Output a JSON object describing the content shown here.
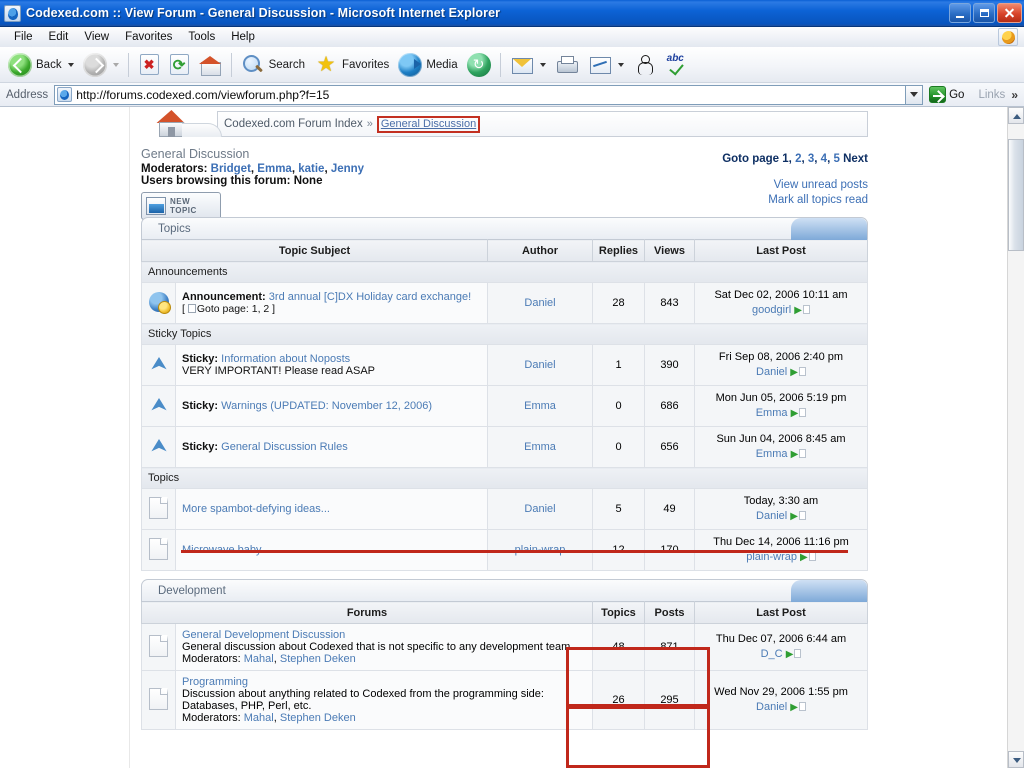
{
  "window": {
    "title": "Codexed.com :: View Forum - General Discussion - Microsoft Internet Explorer",
    "minimize_label": "Minimize",
    "maximize_label": "Restore",
    "close_label": "Close"
  },
  "menu": {
    "items": [
      "File",
      "Edit",
      "View",
      "Favorites",
      "Tools",
      "Help"
    ]
  },
  "toolbar": {
    "back": "Back",
    "forward": "",
    "stop": "",
    "refresh": "",
    "home": "",
    "search": "Search",
    "favorites": "Favorites",
    "media": "Media",
    "history": "",
    "mail": "",
    "print": "",
    "edit": "",
    "messenger": "",
    "spell": ""
  },
  "address": {
    "label": "Address",
    "url": "http://forums.codexed.com/viewforum.php?f=15",
    "go_label": "Go",
    "links_label": "Links",
    "overflow_label": "»"
  },
  "breadcrumb": {
    "root": "Codexed.com Forum Index",
    "separator": "»",
    "current": "General Discussion"
  },
  "forum_header": {
    "title": "General Discussion",
    "moderators_label": "Moderators:",
    "moderators": [
      "Bridget",
      "Emma",
      "katie",
      "Jenny"
    ],
    "users_browsing": "Users browsing this forum: None",
    "new_topic_line1": "NEW",
    "new_topic_line2": "TOPIC",
    "goto_label": "Goto page",
    "goto_pages": [
      "1",
      "2",
      "3",
      "4",
      "5"
    ],
    "goto_next": "Next",
    "view_unread": "View unread posts",
    "mark_read": "Mark all topics read"
  },
  "topics_section": {
    "tab_label": "Topics",
    "columns": [
      "Topic Subject",
      "Author",
      "Replies",
      "Views",
      "Last Post"
    ],
    "groups": [
      {
        "label": "Announcements",
        "rows": [
          {
            "icon": "announcement-icon",
            "prefix": "Announcement:",
            "subject": "3rd annual [C]DX Holiday card exchange!",
            "goto_prefix": "[",
            "goto_label": "Goto page:",
            "goto_pages": "1, 2",
            "goto_suffix": "]",
            "author": "Daniel",
            "replies": "28",
            "views": "843",
            "last_post_date": "Sat Dec 02, 2006 10:11 am",
            "last_post_author": "goodgirl"
          }
        ]
      },
      {
        "label": "Sticky Topics",
        "rows": [
          {
            "icon": "sticky-icon",
            "prefix": "Sticky:",
            "subject": "Information about Noposts",
            "subtitle": "VERY IMPORTANT! Please read ASAP",
            "author": "Daniel",
            "replies": "1",
            "views": "390",
            "last_post_date": "Fri Sep 08, 2006 2:40 pm",
            "last_post_author": "Daniel"
          },
          {
            "icon": "sticky-icon",
            "prefix": "Sticky:",
            "subject": "Warnings (UPDATED: November 12, 2006)",
            "author": "Emma",
            "replies": "0",
            "views": "686",
            "last_post_date": "Mon Jun 05, 2006 5:19 pm",
            "last_post_author": "Emma"
          },
          {
            "icon": "sticky-icon",
            "prefix": "Sticky:",
            "subject": "General Discussion Rules",
            "author": "Emma",
            "replies": "0",
            "views": "656",
            "last_post_date": "Sun Jun 04, 2006 8:45 am",
            "last_post_author": "Emma"
          }
        ]
      },
      {
        "label": "Topics",
        "rows": [
          {
            "icon": "document-icon",
            "subject": "More spambot-defying ideas...",
            "author": "Daniel",
            "replies": "5",
            "views": "49",
            "last_post_date": "Today, 3:30 am",
            "last_post_author": "Daniel",
            "annotation": "red-underline"
          },
          {
            "icon": "document-icon",
            "subject": "Microwave baby",
            "author": "plain-wrap",
            "replies": "12",
            "views": "170",
            "last_post_date": "Thu Dec 14, 2006 11:16 pm",
            "last_post_author": "plain-wrap"
          }
        ]
      }
    ]
  },
  "development_section": {
    "tab_label": "Development",
    "columns": [
      "Forums",
      "Topics",
      "Posts",
      "Last Post"
    ],
    "rows": [
      {
        "icon": "document-icon",
        "name": "General Development Discussion",
        "description": "General discussion about Codexed that is not specific to any development team",
        "moderators_label": "Moderators:",
        "moderators": [
          "Mahal",
          "Stephen Deken"
        ],
        "topics": "48",
        "posts": "871",
        "last_post_date": "Thu Dec 07, 2006 6:44 am",
        "last_post_author": "D_C",
        "annotation": "red-box"
      },
      {
        "icon": "document-icon",
        "name": "Programming",
        "description": "Discussion about anything related to Codexed from the programming side: Databases, PHP, Perl, etc.",
        "moderators_label": "Moderators:",
        "moderators": [
          "Mahal",
          "Stephen Deken"
        ],
        "topics": "26",
        "posts": "295",
        "last_post_date": "Wed Nov 29, 2006 1:55 pm",
        "last_post_author": "Daniel",
        "annotation": "red-box"
      }
    ]
  },
  "colors": {
    "annotation_red": "#c0281b",
    "link_blue": "#4b7bb5",
    "titlebar_blue": "#0d63d6",
    "tab_blue": "#7ea9d8"
  }
}
